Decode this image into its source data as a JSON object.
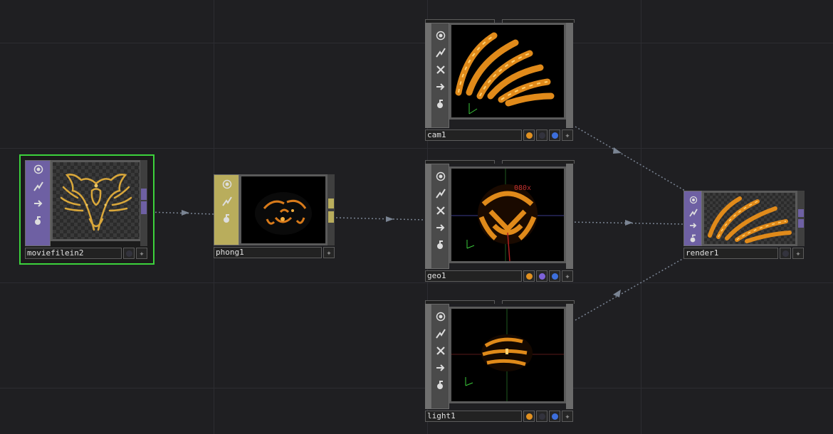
{
  "colors": {
    "background": "#1f1f22",
    "grid": "#2b2b30",
    "wire": "#7a8493",
    "top_strip": "#6e60a3",
    "mat_strip": "#b9ad5c",
    "comp_strip": "#6f6f6f",
    "selection": "#3cd23c",
    "flag_orange": "#e09020",
    "flag_blue": "#3d6fdc",
    "flag_purple": "#7d62d8",
    "flag_dark": "#33333d"
  },
  "nodes": {
    "moviefilein2": {
      "label": "moviefilein2",
      "family": "TOP",
      "selected": true,
      "icons": [
        "viewer-icon",
        "cook-icon",
        "export-icon",
        "lock-icon"
      ]
    },
    "phong1": {
      "label": "phong1",
      "family": "MAT",
      "icons": [
        "viewer-icon",
        "cook-icon",
        "lock-icon"
      ]
    },
    "cam1": {
      "label": "cam1",
      "family": "COMP",
      "icons": [
        "viewer-icon",
        "cook-icon",
        "bypass-icon",
        "export-icon",
        "lock-icon"
      ],
      "flags": [
        "orange",
        "dark",
        "blue"
      ]
    },
    "geo1": {
      "label": "geo1",
      "family": "COMP",
      "viewport_text": "080x",
      "icons": [
        "viewer-icon",
        "cook-icon",
        "bypass-icon",
        "export-icon",
        "lock-icon"
      ],
      "flags": [
        "orange",
        "purple",
        "blue"
      ]
    },
    "light1": {
      "label": "light1",
      "family": "COMP",
      "icons": [
        "viewer-icon",
        "cook-icon",
        "bypass-icon",
        "export-icon",
        "lock-icon"
      ],
      "flags": [
        "orange",
        "dark",
        "blue"
      ]
    },
    "render1": {
      "label": "render1",
      "family": "TOP",
      "icons": [
        "viewer-icon",
        "cook-icon",
        "export-icon",
        "lock-icon"
      ]
    }
  },
  "axes": {
    "y": "y",
    "x": "x",
    "z": "z"
  }
}
